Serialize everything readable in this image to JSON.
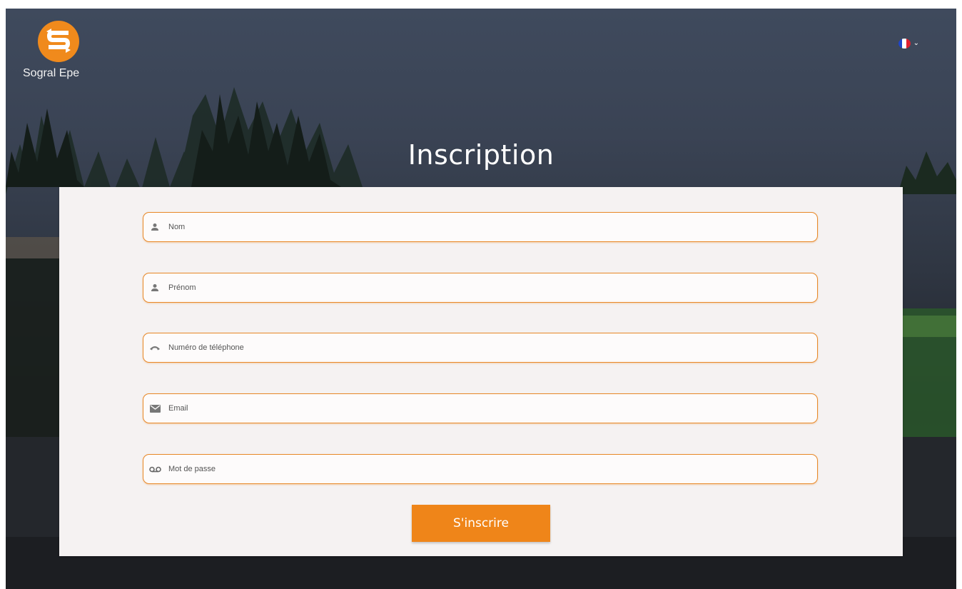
{
  "brand": {
    "name": "Sogral Epe"
  },
  "language": {
    "current": "fr",
    "icon": "france-flag-icon"
  },
  "title": "Inscription",
  "form": {
    "fields": [
      {
        "placeholder": "Nom",
        "icon": "person-icon",
        "value": ""
      },
      {
        "placeholder": "Prénom",
        "icon": "person-icon",
        "value": ""
      },
      {
        "placeholder": "Numéro de téléphone",
        "icon": "phone-icon",
        "value": ""
      },
      {
        "placeholder": "Email",
        "icon": "mail-icon",
        "value": ""
      },
      {
        "placeholder": "Mot de passe",
        "icon": "voicemail-icon",
        "value": ""
      }
    ],
    "submit_label": "S'inscrire"
  },
  "colors": {
    "accent": "#ef8519",
    "border": "#e8892a",
    "card": "#f5f2f2"
  }
}
